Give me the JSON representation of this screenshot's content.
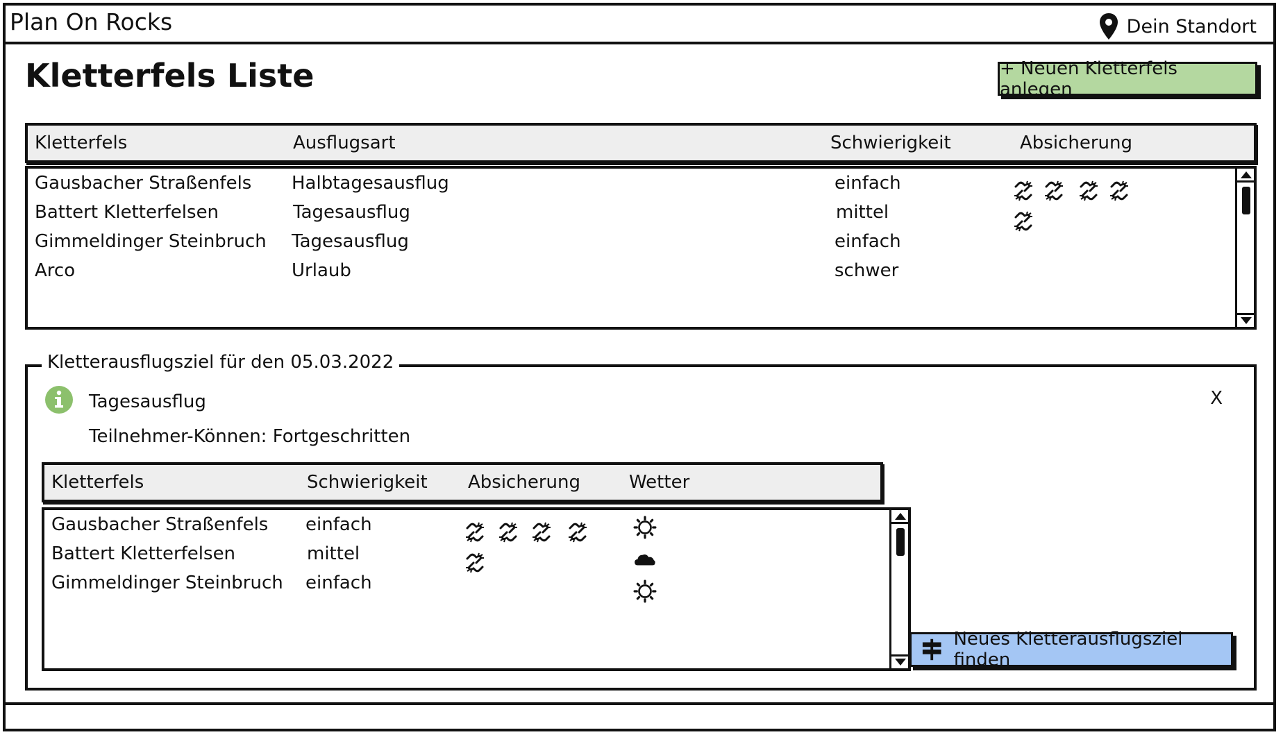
{
  "app": {
    "title": "Plan On Rocks",
    "location_label": "Dein Standort"
  },
  "page": {
    "title": "Kletterfels Liste",
    "add_button_label": "+ Neuen Kletterfels anlegen"
  },
  "rock_table": {
    "headers": [
      "Kletterfels",
      "Ausflugsart",
      "Schwierigkeit",
      "Absicherung"
    ],
    "rows": [
      {
        "name": "Gausbacher Straßenfels",
        "type": "Halbtagesausflug",
        "difficulty": "einfach",
        "protection": 4
      },
      {
        "name": "Battert Kletterfelsen",
        "type": "Tagesausflug",
        "difficulty": "mittel",
        "protection": 1
      },
      {
        "name": "Gimmeldinger Steinbruch",
        "type": "Tagesausflug",
        "difficulty": "einfach",
        "protection": 0
      },
      {
        "name": "Arco",
        "type": "Urlaub",
        "difficulty": "schwer",
        "protection": 0
      }
    ]
  },
  "trip_panel": {
    "legend": "Kletterausflugsziel für den 05.03.2022",
    "trip_type": "Tagesausflug",
    "skill": "Teilnehmer-Können: Fortgeschritten",
    "close_label": "X",
    "headers": [
      "Kletterfels",
      "Schwierigkeit",
      "Absicherung",
      "Wetter"
    ],
    "rows": [
      {
        "name": "Gausbacher Straßenfels",
        "difficulty": "einfach",
        "protection": 4,
        "weather": "sun-icon"
      },
      {
        "name": "Battert Kletterfelsen",
        "difficulty": "mittel",
        "protection": 1,
        "weather": "cloud-icon"
      },
      {
        "name": "Gimmeldinger Steinbruch",
        "difficulty": "einfach",
        "protection": 0,
        "weather": "sun-icon"
      }
    ],
    "find_button_label": "Neues Kletterausflugsziel finden"
  },
  "colors": {
    "add_button": "#b4d8a0",
    "find_button": "#a4c6f4",
    "info_icon": "#8cc06c",
    "header_bg": "#eeeeee"
  }
}
